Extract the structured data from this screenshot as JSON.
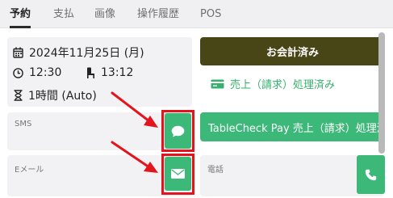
{
  "tabs": [
    {
      "label": "予約",
      "active": true
    },
    {
      "label": "支払",
      "active": false
    },
    {
      "label": "画像",
      "active": false
    },
    {
      "label": "操作履歴",
      "active": false
    },
    {
      "label": "POS",
      "active": false
    }
  ],
  "reservation": {
    "date": "2024年11月25日 (月)",
    "time": "12:30",
    "seat_time": "13:12",
    "duration": "1時間 (Auto)"
  },
  "payment": {
    "paid_button": "お会計済み",
    "sales_status": "売上（請求）処理済み",
    "tablecheck_pay_button": "TableCheck Pay 売上（請求）処理済み"
  },
  "contact": {
    "sms_label": "SMS",
    "email_label": "Eメール",
    "phone_label": "電話"
  },
  "colors": {
    "accent_green": "#3cb878",
    "olive": "#484516",
    "highlight_red": "#e3141b"
  },
  "icons": {
    "calendar": "calendar-icon",
    "clock": "clock-icon",
    "chair": "chair-icon",
    "hourglass": "hourglass-icon",
    "money": "money-icon",
    "chat": "chat-icon",
    "mail": "mail-icon",
    "phone": "phone-icon",
    "arrow": "arrow-icon"
  }
}
